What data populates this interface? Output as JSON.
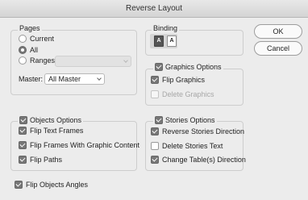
{
  "window": {
    "title": "Reverse Layout"
  },
  "pages": {
    "legend": "Pages",
    "current_label": "Current",
    "all_label": "All",
    "ranges_label": "Ranges:",
    "master_label": "Master:",
    "master_value": "All Master"
  },
  "binding": {
    "legend": "Binding",
    "left_glyph": "A",
    "right_glyph": "A"
  },
  "buttons": {
    "ok": "OK",
    "cancel": "Cancel"
  },
  "graphics": {
    "legend": "Graphics Options",
    "flip_graphics": "Flip Graphics",
    "delete_graphics": "Delete Graphics"
  },
  "objects": {
    "legend": "Objects Options",
    "flip_text_frames": "Flip Text Frames",
    "flip_frames_graphic": "Flip Frames With Graphic Content",
    "flip_paths": "Flip Paths"
  },
  "stories": {
    "legend": "Stories Options",
    "reverse_direction": "Reverse Stories Direction",
    "delete_text": "Delete Stories Text",
    "change_table": "Change Table(s) Direction"
  },
  "flip_objects_angles": "Flip Objects Angles"
}
